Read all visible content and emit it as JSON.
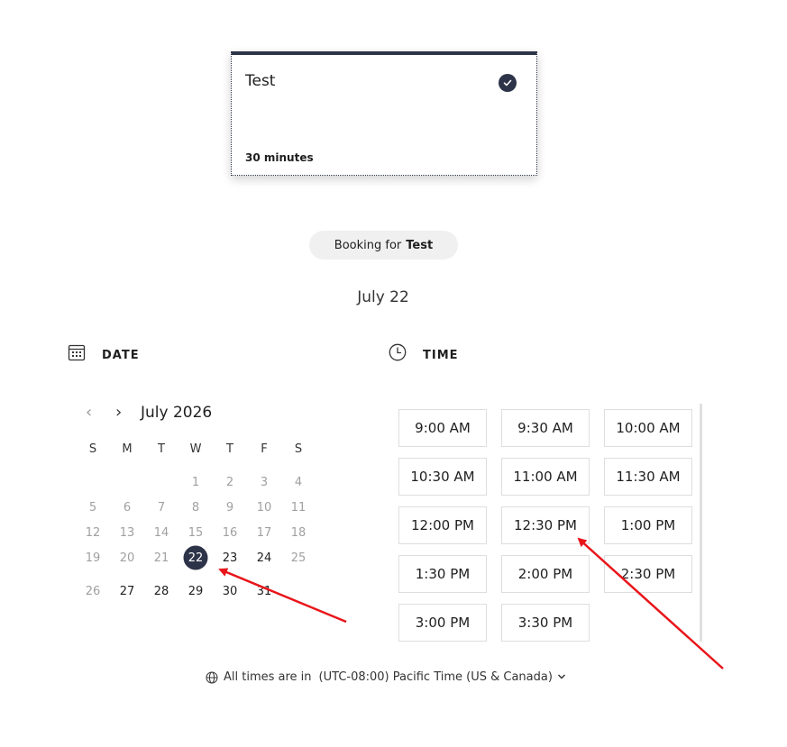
{
  "service_card": {
    "title": "Test",
    "duration": "30 minutes"
  },
  "booking": {
    "prefix": "Booking for",
    "service": "Test"
  },
  "selected_date": "July 22",
  "date_section": {
    "label": "DATE",
    "icon": "calendar-icon"
  },
  "time_section": {
    "label": "TIME",
    "icon": "clock-icon"
  },
  "calendar": {
    "month_title": "July 2026",
    "prev_icon": "‹",
    "next_icon": "›",
    "weekdays": [
      "S",
      "M",
      "T",
      "W",
      "T",
      "F",
      "S"
    ],
    "weeks": [
      [
        null,
        null,
        null,
        "1",
        "2",
        "3",
        "4"
      ],
      [
        "5",
        "6",
        "7",
        "8",
        "9",
        "10",
        "11"
      ],
      [
        "12",
        "13",
        "14",
        "15",
        "16",
        "17",
        "18"
      ],
      [
        "19",
        "20",
        "21",
        "22",
        "23",
        "24",
        "25"
      ],
      [
        "26",
        "27",
        "28",
        "29",
        "30",
        "31",
        null
      ]
    ],
    "available_days": [
      "23",
      "24",
      "27",
      "28",
      "29",
      "30",
      "31"
    ],
    "selected_day": "22"
  },
  "time_slots": [
    "9:00 AM",
    "9:30 AM",
    "10:00 AM",
    "10:30 AM",
    "11:00 AM",
    "11:30 AM",
    "12:00 PM",
    "12:30 PM",
    "1:00 PM",
    "1:30 PM",
    "2:00 PM",
    "2:30 PM",
    "3:00 PM",
    "3:30 PM"
  ],
  "timezone": {
    "prefix": "All times are in",
    "value": "(UTC-08:00) Pacific Time (US & Canada)"
  },
  "colors": {
    "accent": "#2d3348",
    "annotation": "#e8151b"
  }
}
